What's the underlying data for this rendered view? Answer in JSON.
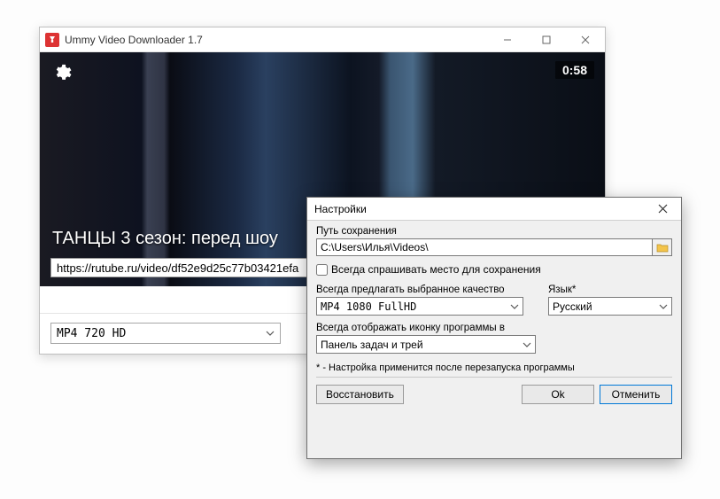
{
  "window": {
    "title": "Ummy Video Downloader 1.7"
  },
  "video": {
    "duration": "0:58",
    "title": "ТАНЦЫ 3 сезон: перед шоу",
    "url": "https://rutube.ru/video/df52e9d25c77b03421efa",
    "format": "MP4  720  HD"
  },
  "settings": {
    "title": "Настройки",
    "save_path_label": "Путь сохранения",
    "save_path": "C:\\Users\\Илья\\Videos\\",
    "always_ask_label": "Всегда спрашивать место для сохранения",
    "always_ask_checked": false,
    "quality_label": "Всегда предлагать выбранное качество",
    "quality_value": "MP4  1080  FullHD",
    "language_label": "Язык*",
    "language_value": "Русский",
    "tray_label": "Всегда отображать иконку программы в",
    "tray_value": "Панель задач и трей",
    "footnote": "* - Настройка применится после перезапуска программы",
    "restore": "Восстановить",
    "ok": "Ok",
    "cancel": "Отменить"
  }
}
